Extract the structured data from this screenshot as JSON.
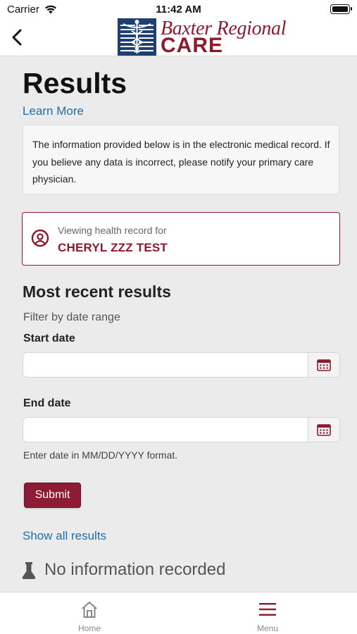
{
  "status_bar": {
    "carrier": "Carrier",
    "time": "11:42 AM"
  },
  "nav": {
    "logo_line1": "Baxter Regional",
    "logo_line2": "CARE",
    "brand_color": "#8b1a2f"
  },
  "page": {
    "title": "Results",
    "learn_more": "Learn More",
    "info_text": "The information provided below is in the electronic medical record. If you believe any data is incorrect, please notify your primary care physician."
  },
  "record": {
    "label": "Viewing health record for",
    "patient_name": "CHERYL ZZZ TEST"
  },
  "results": {
    "heading": "Most recent results",
    "filter_label": "Filter by date range",
    "start_date_label": "Start date",
    "start_date_value": "",
    "end_date_label": "End date",
    "end_date_value": "",
    "hint": "Enter date in MM/DD/YYYY format.",
    "submit_label": "Submit",
    "show_all_label": "Show all results",
    "no_info_text": "No information recorded"
  },
  "tab_bar": {
    "home_label": "Home",
    "menu_label": "Menu",
    "active_color": "#8b1a2f"
  }
}
